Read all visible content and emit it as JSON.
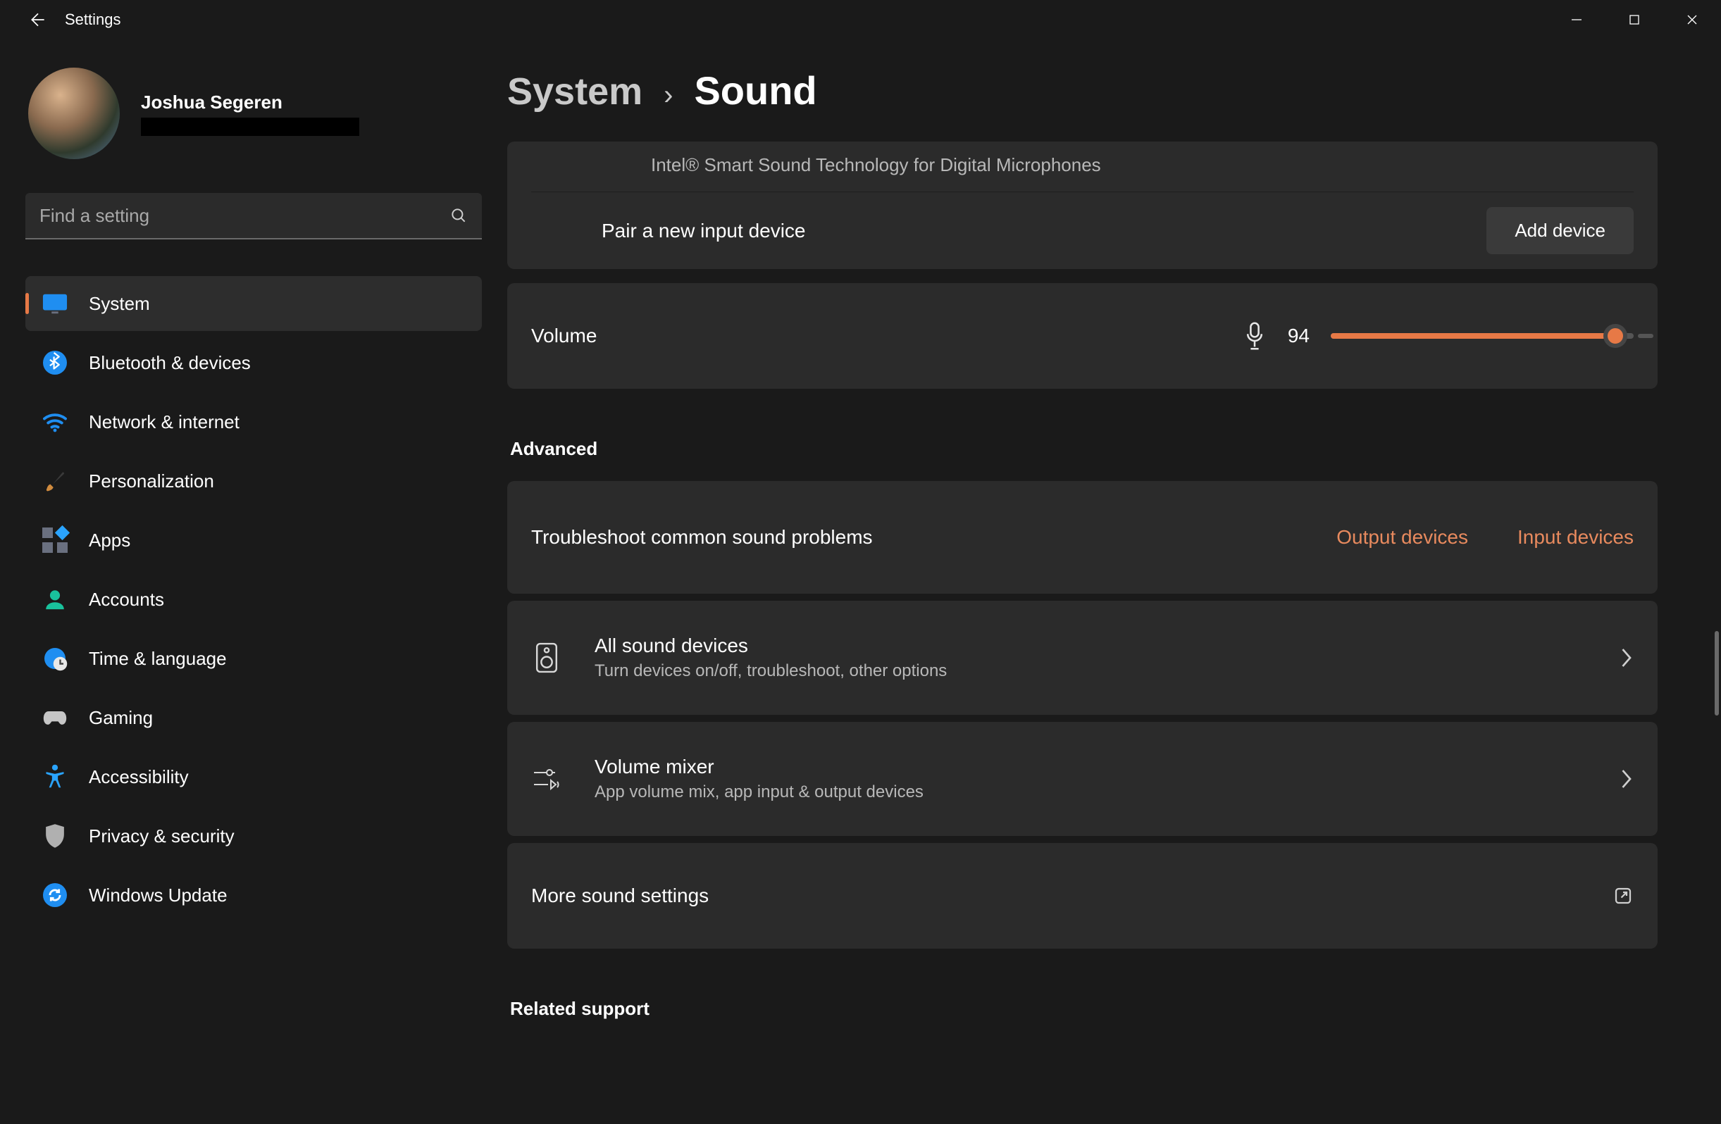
{
  "app": {
    "title": "Settings"
  },
  "user": {
    "name": "Joshua Segeren"
  },
  "search": {
    "placeholder": "Find a setting"
  },
  "sidebar": {
    "items": [
      {
        "label": "System"
      },
      {
        "label": "Bluetooth & devices"
      },
      {
        "label": "Network & internet"
      },
      {
        "label": "Personalization"
      },
      {
        "label": "Apps"
      },
      {
        "label": "Accounts"
      },
      {
        "label": "Time & language"
      },
      {
        "label": "Gaming"
      },
      {
        "label": "Accessibility"
      },
      {
        "label": "Privacy & security"
      },
      {
        "label": "Windows Update"
      }
    ]
  },
  "breadcrumb": {
    "parent": "System",
    "page": "Sound"
  },
  "input_device": {
    "subtitle": "Intel® Smart Sound Technology for Digital Microphones",
    "pair_label": "Pair a new input device",
    "add_button": "Add device"
  },
  "volume": {
    "label": "Volume",
    "value": "94",
    "percent": 94
  },
  "sections": {
    "advanced": "Advanced",
    "related": "Related support"
  },
  "troubleshoot": {
    "label": "Troubleshoot common sound problems",
    "output_link": "Output devices",
    "input_link": "Input devices"
  },
  "all_devices": {
    "title": "All sound devices",
    "sub": "Turn devices on/off, troubleshoot, other options"
  },
  "mixer": {
    "title": "Volume mixer",
    "sub": "App volume mix, app input & output devices"
  },
  "more": {
    "label": "More sound settings"
  }
}
